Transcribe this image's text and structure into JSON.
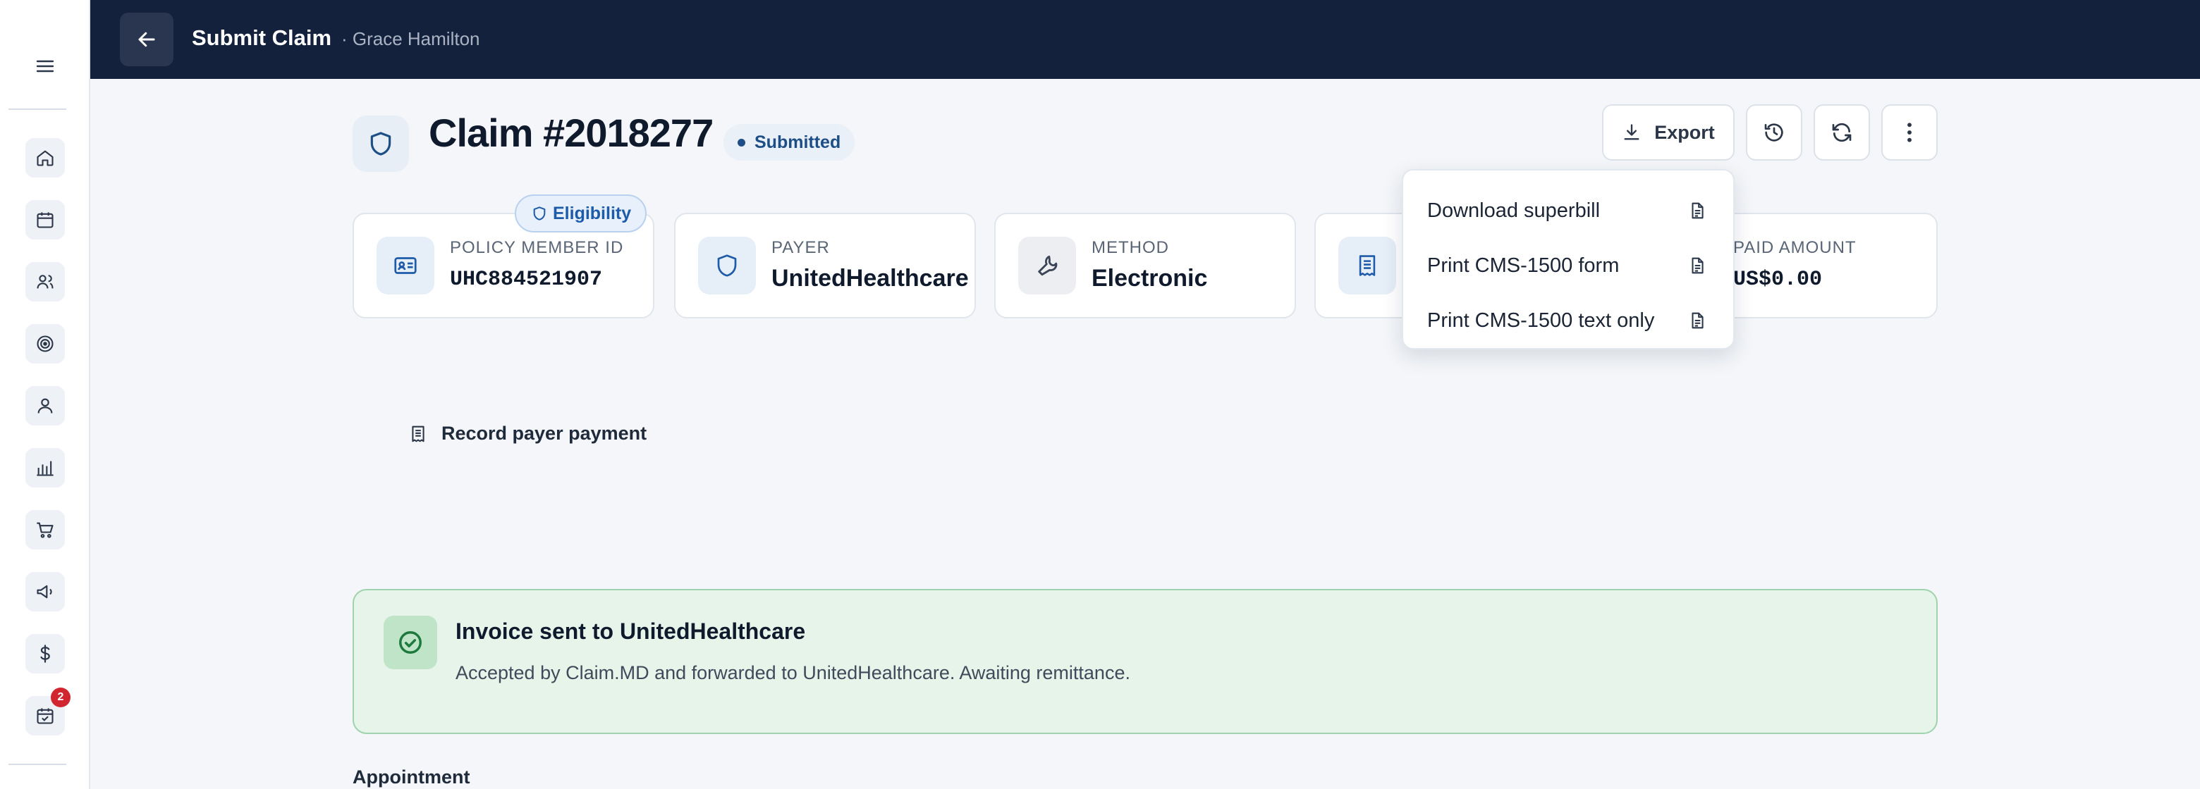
{
  "header": {
    "title": "Submit Claim",
    "subtitle": "· Grace Hamilton"
  },
  "sidebar": {
    "items": [
      {
        "icon": "home-icon"
      },
      {
        "icon": "calendar-icon"
      },
      {
        "icon": "users-icon"
      },
      {
        "icon": "target-icon"
      },
      {
        "icon": "person-icon"
      },
      {
        "icon": "bar-chart-icon"
      },
      {
        "icon": "cart-icon"
      },
      {
        "icon": "megaphone-icon"
      },
      {
        "icon": "dollar-icon"
      },
      {
        "icon": "calendar-check-icon",
        "badge": "2"
      }
    ]
  },
  "claim": {
    "title": "Claim #2018277",
    "status": "Submitted"
  },
  "toolbar": {
    "export_label": "Export"
  },
  "dropdown": {
    "items": [
      "Download superbill",
      "Print CMS-1500 form",
      "Print CMS-1500 text only"
    ]
  },
  "cards": [
    {
      "label": "Policy member ID",
      "value": "UHC884521907",
      "chip": "Eligibility"
    },
    {
      "label": "Payer",
      "value": "UnitedHealthcare"
    },
    {
      "label": "Method",
      "value": "Electronic"
    },
    {
      "label": "Paid amount",
      "value": "US$0.00"
    }
  ],
  "actions": {
    "record_payment": "Record payer payment"
  },
  "banner": {
    "title": "Invoice sent to UnitedHealthcare",
    "text": "Accepted by Claim.MD and forwarded to UnitedHealthcare. Awaiting remittance."
  },
  "sections": {
    "appointment": "Appointment"
  },
  "colors": {
    "header_bg": "#14213d",
    "status_accent": "#1d4f86",
    "success_bg": "#e6f4ea",
    "badge": "#d1262f"
  }
}
